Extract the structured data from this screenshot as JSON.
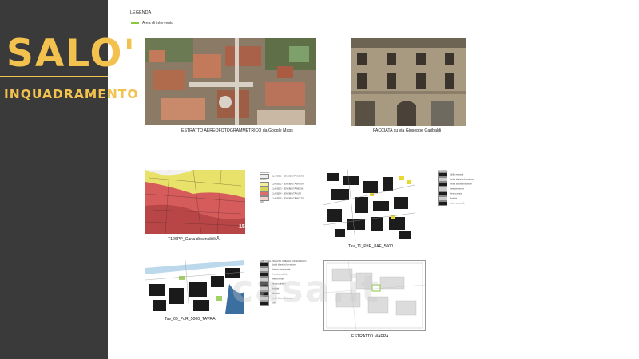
{
  "sidebar": {
    "city": "SALO'",
    "subtitle": "INQUADRAMENTO"
  },
  "legend": {
    "title": "LEGENDA",
    "item": "Area di intervento",
    "color": "#8dc63f"
  },
  "captions": {
    "aerial": "ESTRATTO AEREOFOTOGRAMMETRICO da Google Maps",
    "facade": "FACCIATA su via Giuseppe Garibaldi",
    "carta": "T126PP_Carta di sensibilitÃ",
    "tav11": "Tav_11_PdR_IIAF_5000",
    "tav09": "Tav_09_PdR_5000_TAVRA",
    "mappa": "ESTRATTO MAPPA"
  },
  "carta_map_number": "15",
  "carta_legend": {
    "title": "LEGENDA",
    "items": [
      "CLASSE 1 - SENSIBILITÀ MOLTO BASSA",
      "CLASSE 2 - SENSIBILITÀ BASSA",
      "CLASSE 3 - SENSIBILITÀ MEDIA",
      "CLASSE 4 - SENSIBILITÀ ALTA",
      "CLASSE 5 - SENSIBILITÀ MOLTO ALTA"
    ],
    "colors": [
      "#eeeeee",
      "#f3ef9e",
      "#d8d35a",
      "#e06b6b",
      "#f2d0d0"
    ]
  },
  "tav11_legend": {
    "title": "LEGENDA",
    "items": [
      "Edifici esistenti",
      "Nuclei di antica formazione",
      "Ambiti di trasformazione",
      "Aree per servizi",
      "Verde privato",
      "Viabilità",
      "Limite comunale"
    ]
  },
  "tav09_legend": {
    "title": "AMBITI DEL TESSUTO URBANO CONSOLIDATO",
    "items": [
      "Nuclei di antica formazione",
      "Tessuto residenziale",
      "Tessuto produttivo",
      "Aree a verde",
      "Servizi pubblici",
      "Viabilità",
      "Percorsi",
      "Ambiti di trasformazione",
      "Limiti"
    ]
  },
  "watermark": "casa.it"
}
